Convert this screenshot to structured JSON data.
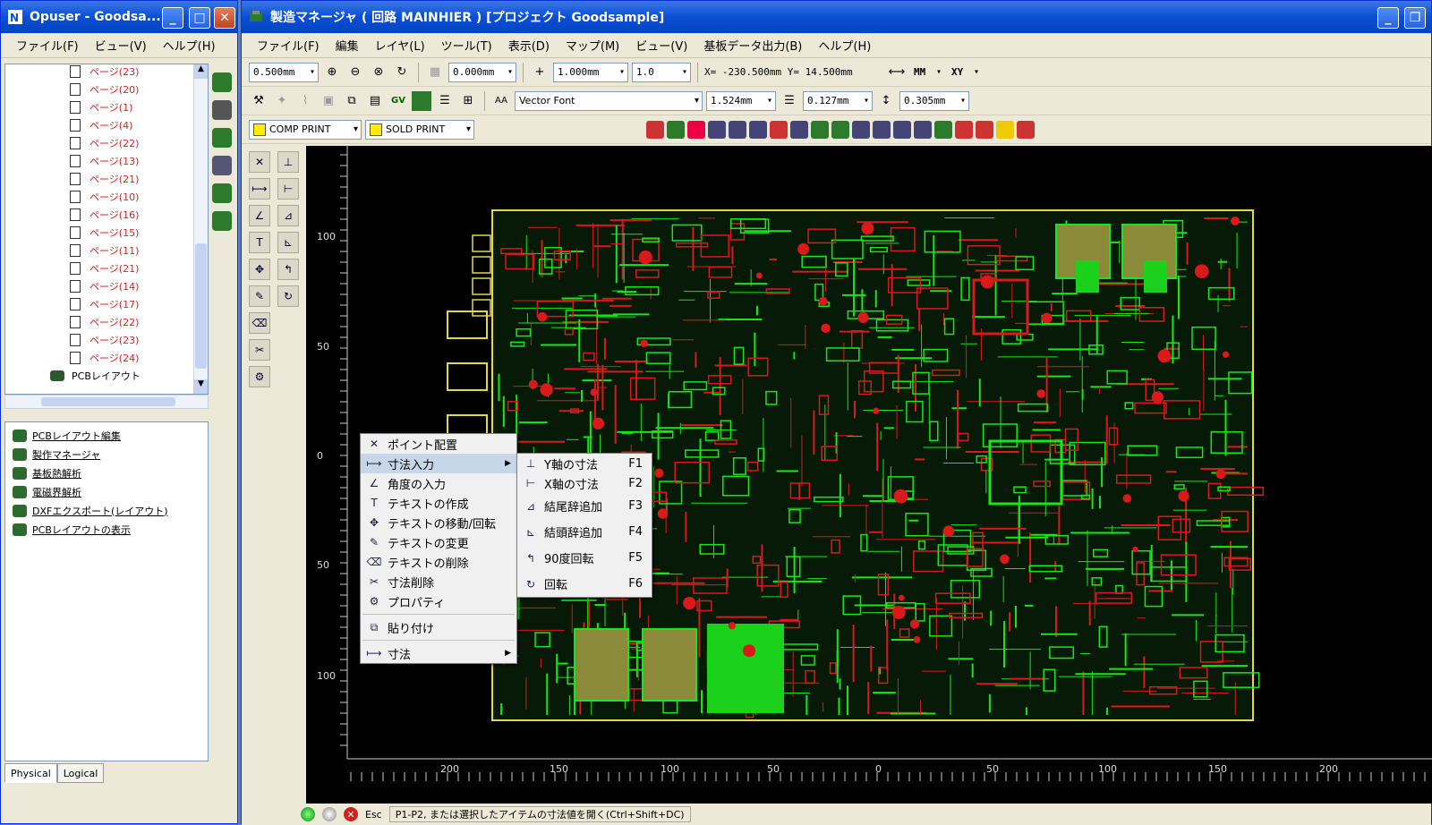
{
  "left_window": {
    "title": "Opuser - Goodsa...",
    "menu": [
      "ファイル(F)",
      "ビュー(V)",
      "ヘルプ(H)"
    ],
    "tree_items": [
      "ページ(23)",
      "ページ(20)",
      "ページ(1)",
      "ページ(4)",
      "ページ(22)",
      "ページ(13)",
      "ページ(21)",
      "ページ(10)",
      "ページ(16)",
      "ページ(15)",
      "ページ(11)",
      "ページ(21)",
      "ページ(14)",
      "ページ(17)",
      "ページ(22)",
      "ページ(23)",
      "ページ(24)"
    ],
    "tree_root": "PCBレイアウト",
    "links": [
      "PCBレイアウト編集",
      "製作マネージャ",
      "基板熱解析",
      "電磁界解析",
      "DXFエクスポート(レイアウト)",
      "PCBレイアウトの表示"
    ],
    "tabs": [
      "Physical",
      "Logical"
    ]
  },
  "main_window": {
    "title": "製造マネージャ ( 回路 MAINHIER ) [プロジェクト Goodsample]",
    "menu": [
      "ファイル(F)",
      "編集",
      "レイヤ(L)",
      "ツール(T)",
      "表示(D)",
      "マップ(M)",
      "ビュー(V)",
      "基板データ出力(B)",
      "ヘルプ(H)"
    ],
    "toolbar1": {
      "grid": "0.500mm",
      "snap": "0.000mm",
      "line_width": "1.000mm",
      "ratio": "1.0",
      "coords": "X= -230.500mm Y= 14.500mm",
      "units": "MM",
      "axis": "XY"
    },
    "toolbar2": {
      "font": "Vector Font",
      "text_height": "1.524mm",
      "line_thickness": "0.127mm",
      "spacing": "0.305mm"
    },
    "toolbar3": {
      "layer1": "COMP PRINT",
      "layer2": "SOLD PRINT"
    },
    "ruler_left": [
      "100",
      "50",
      "0",
      "50",
      "100"
    ],
    "ruler_bottom": [
      "200",
      "150",
      "100",
      "50",
      "0",
      "50",
      "100",
      "150",
      "200"
    ],
    "status": {
      "esc_label": "Esc",
      "message": "P1-P2, または選択したアイテムの寸法値を開く(Ctrl+Shift+DC)"
    }
  },
  "context_menu": {
    "items": [
      {
        "label": "ポイント配置"
      },
      {
        "label": "寸法入力",
        "submenu": true
      },
      {
        "label": "角度の入力"
      },
      {
        "label": "テキストの作成"
      },
      {
        "label": "テキストの移動/回転"
      },
      {
        "label": "テキストの変更"
      },
      {
        "label": "テキストの削除"
      },
      {
        "label": "寸法削除"
      },
      {
        "label": "プロパティ"
      },
      {
        "label": "貼り付け"
      },
      {
        "label": "寸法",
        "submenu": true
      }
    ],
    "submenu": [
      {
        "label": "Y軸の寸法",
        "key": "F1"
      },
      {
        "label": "X軸の寸法",
        "key": "F2"
      },
      {
        "label": "結尾辞追加",
        "key": "F3"
      },
      {
        "label": "結頭辞追加",
        "key": "F4"
      },
      {
        "label": "90度回転",
        "key": "F5"
      },
      {
        "label": "回転",
        "key": "F6"
      }
    ]
  },
  "colors": {
    "trace_green": "#19e619",
    "trace_red": "#d81a1a",
    "pad_olive": "#8a8a3a",
    "board_outline": "#e0d84a",
    "canvas_bg": "#000000",
    "xp_blue": "#0a4fd4"
  }
}
